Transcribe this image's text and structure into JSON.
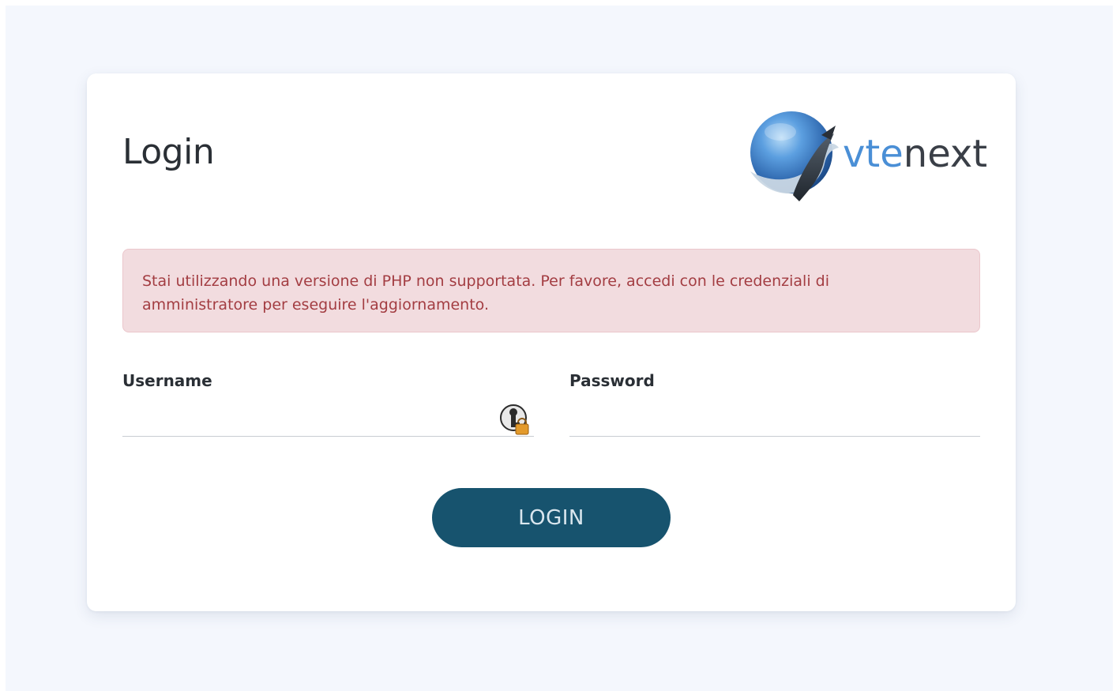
{
  "login": {
    "title": "Login",
    "logo": {
      "text_part1": "vte",
      "text_part2": "next"
    },
    "alert": {
      "line1": "Stai utilizzando una versione di PHP non supportata. Per favore, accedi con le credenziali di",
      "line2": "amministratore per eseguire l'aggiornamento."
    },
    "username": {
      "label": "Username",
      "value": ""
    },
    "password": {
      "label": "Password",
      "value": ""
    },
    "button_label": "LOGIN"
  },
  "colors": {
    "background": "#f4f7fd",
    "alert_bg": "#f2dcdf",
    "alert_text": "#a33d42",
    "button": "#17536e",
    "logo_blue": "#4a8fd6",
    "logo_dark": "#3a3f47"
  },
  "icons": {
    "logo": "whale-globe-logo",
    "password_manager": "key-lock-icon"
  }
}
